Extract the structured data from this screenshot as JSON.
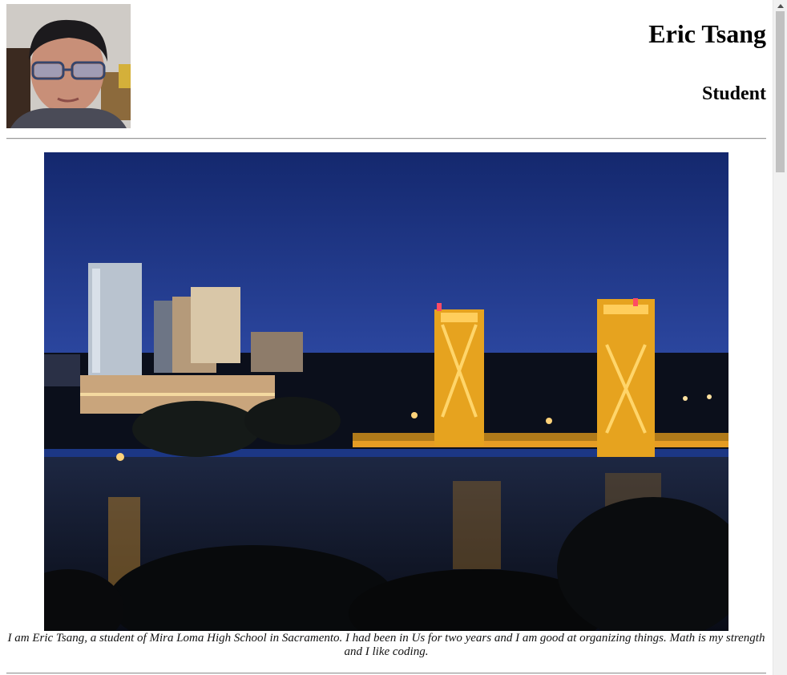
{
  "profile": {
    "name": "Eric Tsang",
    "role": "Student",
    "avatar_description": "portrait-photo"
  },
  "hero": {
    "image_description": "city-skyline-bridge-night-photo"
  },
  "bio": {
    "text": "I am Eric Tsang, a student of Mira Loma High School in Sacramento. I had been in Us for two years and I am good at organizing things. Math is my strength and I like coding."
  },
  "colors": {
    "sky": "#1c3785",
    "bridge_glow": "#f2b21c",
    "water": "#131b33",
    "divider": "#9a9a9a"
  }
}
